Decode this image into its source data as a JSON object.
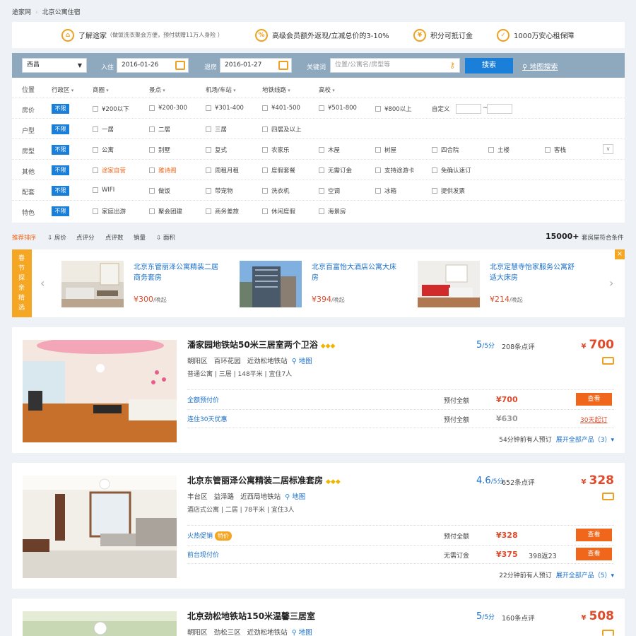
{
  "breadcrumb": {
    "home": "途家网",
    "current": "北京公寓住宿"
  },
  "promos": [
    {
      "icon": "house-icon",
      "title": "了解途家",
      "sub": "（做饭洗衣聚会方便，预付就赠11万人身险 ）"
    },
    {
      "icon": "percent-icon",
      "title": "高级会员额外返现/立减总价的3-10%",
      "sub": ""
    },
    {
      "icon": "coin-icon",
      "title": "积分可抵订金",
      "sub": ""
    },
    {
      "icon": "shield-icon",
      "title": "1000万安心租保障",
      "sub": ""
    }
  ],
  "search": {
    "city": "西昌",
    "checkin_label": "入住",
    "checkin": "2016-01-26",
    "checkout_label": "退房",
    "checkout": "2016-01-27",
    "keyword_label": "关键词",
    "keyword_placeholder": "位置/公寓名/房型等",
    "button": "搜索",
    "map_link": "地图搜索"
  },
  "filters": {
    "nolimit": "不限",
    "location": {
      "label": "位置",
      "dropdowns": [
        "行政区",
        "商圈",
        "景点",
        "机场/车站",
        "地铁线路",
        "高校"
      ]
    },
    "price": {
      "label": "房价",
      "options": [
        "¥200以下",
        "¥200-300",
        "¥301-400",
        "¥401-500",
        "¥501-800",
        "¥800以上"
      ],
      "custom": "自定义",
      "dash": "~"
    },
    "layout": {
      "label": "户型",
      "options": [
        "一居",
        "二居",
        "三居",
        "四居及以上"
      ]
    },
    "type": {
      "label": "房型",
      "options": [
        "公寓",
        "别墅",
        "复式",
        "农家乐",
        "木屋",
        "树屋",
        "四合院",
        "土楼",
        "客栈"
      ]
    },
    "other": {
      "label": "其他",
      "options": [
        "途家自营",
        "雅诗阁",
        "周租月租",
        "度假套餐",
        "无需订金",
        "支持途游卡",
        "免确认速订"
      ]
    },
    "facilities": {
      "label": "配套",
      "options": [
        "WIFI",
        "做饭",
        "带宠物",
        "洗衣机",
        "空调",
        "冰箱",
        "提供发票"
      ]
    },
    "features": {
      "label": "特色",
      "options": [
        "家庭出游",
        "聚会团建",
        "商务差旅",
        "休闲度假",
        "海景房"
      ]
    }
  },
  "sort": {
    "items": [
      "推荐排序",
      "⇩ 房价",
      "点评分",
      "点评数",
      "销量",
      "⇩ 面积"
    ],
    "count": "15000+",
    "count_suffix": "套房屋符合条件"
  },
  "special": {
    "label": "春节探亲精选",
    "close": "×",
    "items": [
      {
        "title": "北京东管丽泽公寓精装二居商务套房",
        "price": "¥300",
        "suffix": "/晚起"
      },
      {
        "title": "北京百富怡大酒店公寓大床房",
        "price": "¥394",
        "suffix": "/晚起"
      },
      {
        "title": "北京定慧寺怡家服务公寓舒适大床房",
        "price": "¥214",
        "suffix": "/晚起"
      }
    ]
  },
  "listings": [
    {
      "title": "潘家园地铁站50米三居室两个卫浴",
      "district": "朝阳区",
      "area": "百环花园",
      "near": "近劲松地铁站",
      "map": "地图",
      "meta": "普通公寓 | 三居 | 148平米 | 宜住7人",
      "score": "5",
      "score_unit": "/5分",
      "reviews": "208条点评",
      "price": "700",
      "currency": "¥",
      "plans": [
        {
          "name": "全额预付价",
          "type": "预付全额",
          "price": "¥700",
          "gray": false,
          "action": "查看"
        },
        {
          "name": "连住30天优惠",
          "type": "预付全额",
          "price": "¥630",
          "gray": true,
          "link": "30天起订"
        }
      ],
      "foot_note": "54分钟前有人预订",
      "foot_link": "展开全部产品（3）▾"
    },
    {
      "title": "北京东管丽泽公寓精装二居标准套房",
      "district": "丰台区",
      "area": "益泽路",
      "near": "近西局地铁站",
      "map": "地图",
      "meta": "酒店式公寓 | 二居 | 78平米 | 宜住3人",
      "score": "4.6",
      "score_unit": "/5分",
      "reviews": "652条点评",
      "price": "328",
      "currency": "¥",
      "plans": [
        {
          "name": "火热促销",
          "badge": "特价",
          "type": "预付全额",
          "price": "¥328",
          "gray": false,
          "action": "查看"
        },
        {
          "name": "前台现付价",
          "type": "无需订金",
          "price": "¥375",
          "gray": false,
          "extra": "398返23",
          "action": "查看"
        }
      ],
      "foot_note": "22分钟前有人预订",
      "foot_link": "展开全部产品（5）▾"
    },
    {
      "title": "北京劲松地铁站150米温馨三居室",
      "district": "朝阳区",
      "area": "劲松三区",
      "near": "近劲松地铁站",
      "map": "地图",
      "score": "5",
      "score_unit": "/5分",
      "reviews": "160条点评",
      "price": "508",
      "currency": "¥"
    }
  ]
}
